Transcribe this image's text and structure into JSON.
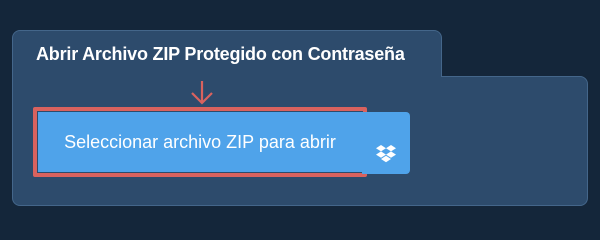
{
  "panel": {
    "title": "Abrir Archivo ZIP Protegido con Contraseña"
  },
  "actions": {
    "select_label": "Seleccionar archivo ZIP para abrir",
    "dropbox_icon": "dropbox-icon"
  },
  "annotation": {
    "arrow_icon": "arrow-down-icon",
    "highlight_color": "#d9625e"
  },
  "colors": {
    "background": "#14263a",
    "panel": "#2d4b6c",
    "button": "#4fa3ea"
  }
}
